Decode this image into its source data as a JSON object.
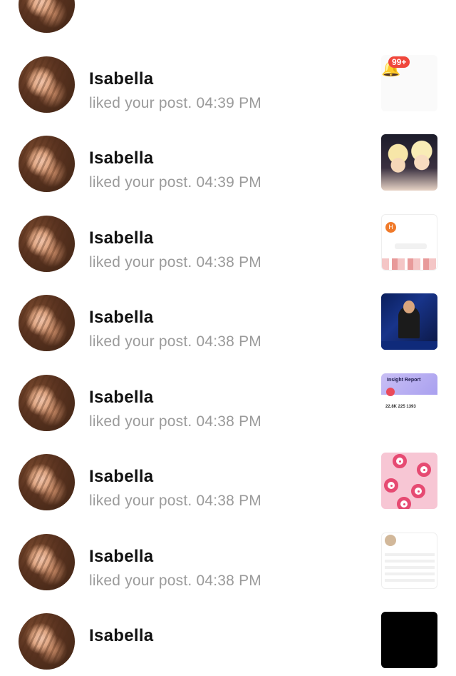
{
  "notifications": [
    {
      "name": "",
      "action": "",
      "time": "",
      "thumb_caption": "",
      "thumb_kind": "text"
    },
    {
      "name": "Isabella",
      "action": "liked your post.",
      "time": "04:39 PM",
      "thumb_caption": "99+",
      "thumb_kind": "bell"
    },
    {
      "name": "Isabella",
      "action": "liked your post.",
      "time": "04:39 PM",
      "thumb_caption": "",
      "thumb_kind": "photo-two-women"
    },
    {
      "name": "Isabella",
      "action": "liked your post.",
      "time": "04:38 PM",
      "thumb_caption": "H",
      "thumb_kind": "profile-screenshot"
    },
    {
      "name": "Isabella",
      "action": "liked your post.",
      "time": "04:38 PM",
      "thumb_caption": "",
      "thumb_kind": "news-broadcast"
    },
    {
      "name": "Isabella",
      "action": "liked your post.",
      "time": "04:38 PM",
      "thumb_caption": "Insight Report",
      "thumb_kind": "insight-report"
    },
    {
      "name": "Isabella",
      "action": "liked your post.",
      "time": "04:38 PM",
      "thumb_caption": "",
      "thumb_kind": "pink-pattern"
    },
    {
      "name": "Isabella",
      "action": "liked your post.",
      "time": "04:38 PM",
      "thumb_caption": "",
      "thumb_kind": "profile-screenshot-2"
    },
    {
      "name": "Isabella",
      "action": "",
      "time": "",
      "thumb_caption": "",
      "thumb_kind": "black"
    }
  ],
  "thumb_details": {
    "insight_numbers": "22.8K   225   1393"
  },
  "colors": {
    "name_text": "#111111",
    "subtitle_text": "#9b9b9b",
    "badge": "#f0473c"
  }
}
